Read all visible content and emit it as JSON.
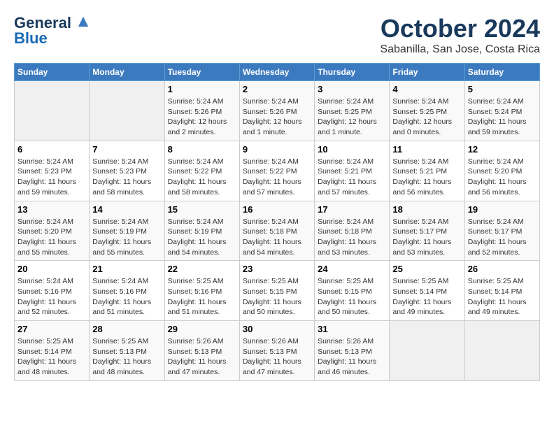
{
  "logo": {
    "general": "General",
    "blue": "Blue"
  },
  "title": "October 2024",
  "subtitle": "Sabanilla, San Jose, Costa Rica",
  "headers": [
    "Sunday",
    "Monday",
    "Tuesday",
    "Wednesday",
    "Thursday",
    "Friday",
    "Saturday"
  ],
  "weeks": [
    [
      {
        "day": "",
        "info": ""
      },
      {
        "day": "",
        "info": ""
      },
      {
        "day": "1",
        "info": "Sunrise: 5:24 AM\nSunset: 5:26 PM\nDaylight: 12 hours\nand 2 minutes."
      },
      {
        "day": "2",
        "info": "Sunrise: 5:24 AM\nSunset: 5:26 PM\nDaylight: 12 hours\nand 1 minute."
      },
      {
        "day": "3",
        "info": "Sunrise: 5:24 AM\nSunset: 5:25 PM\nDaylight: 12 hours\nand 1 minute."
      },
      {
        "day": "4",
        "info": "Sunrise: 5:24 AM\nSunset: 5:25 PM\nDaylight: 12 hours\nand 0 minutes."
      },
      {
        "day": "5",
        "info": "Sunrise: 5:24 AM\nSunset: 5:24 PM\nDaylight: 11 hours\nand 59 minutes."
      }
    ],
    [
      {
        "day": "6",
        "info": "Sunrise: 5:24 AM\nSunset: 5:23 PM\nDaylight: 11 hours\nand 59 minutes."
      },
      {
        "day": "7",
        "info": "Sunrise: 5:24 AM\nSunset: 5:23 PM\nDaylight: 11 hours\nand 58 minutes."
      },
      {
        "day": "8",
        "info": "Sunrise: 5:24 AM\nSunset: 5:22 PM\nDaylight: 11 hours\nand 58 minutes."
      },
      {
        "day": "9",
        "info": "Sunrise: 5:24 AM\nSunset: 5:22 PM\nDaylight: 11 hours\nand 57 minutes."
      },
      {
        "day": "10",
        "info": "Sunrise: 5:24 AM\nSunset: 5:21 PM\nDaylight: 11 hours\nand 57 minutes."
      },
      {
        "day": "11",
        "info": "Sunrise: 5:24 AM\nSunset: 5:21 PM\nDaylight: 11 hours\nand 56 minutes."
      },
      {
        "day": "12",
        "info": "Sunrise: 5:24 AM\nSunset: 5:20 PM\nDaylight: 11 hours\nand 56 minutes."
      }
    ],
    [
      {
        "day": "13",
        "info": "Sunrise: 5:24 AM\nSunset: 5:20 PM\nDaylight: 11 hours\nand 55 minutes."
      },
      {
        "day": "14",
        "info": "Sunrise: 5:24 AM\nSunset: 5:19 PM\nDaylight: 11 hours\nand 55 minutes."
      },
      {
        "day": "15",
        "info": "Sunrise: 5:24 AM\nSunset: 5:19 PM\nDaylight: 11 hours\nand 54 minutes."
      },
      {
        "day": "16",
        "info": "Sunrise: 5:24 AM\nSunset: 5:18 PM\nDaylight: 11 hours\nand 54 minutes."
      },
      {
        "day": "17",
        "info": "Sunrise: 5:24 AM\nSunset: 5:18 PM\nDaylight: 11 hours\nand 53 minutes."
      },
      {
        "day": "18",
        "info": "Sunrise: 5:24 AM\nSunset: 5:17 PM\nDaylight: 11 hours\nand 53 minutes."
      },
      {
        "day": "19",
        "info": "Sunrise: 5:24 AM\nSunset: 5:17 PM\nDaylight: 11 hours\nand 52 minutes."
      }
    ],
    [
      {
        "day": "20",
        "info": "Sunrise: 5:24 AM\nSunset: 5:16 PM\nDaylight: 11 hours\nand 52 minutes."
      },
      {
        "day": "21",
        "info": "Sunrise: 5:24 AM\nSunset: 5:16 PM\nDaylight: 11 hours\nand 51 minutes."
      },
      {
        "day": "22",
        "info": "Sunrise: 5:25 AM\nSunset: 5:16 PM\nDaylight: 11 hours\nand 51 minutes."
      },
      {
        "day": "23",
        "info": "Sunrise: 5:25 AM\nSunset: 5:15 PM\nDaylight: 11 hours\nand 50 minutes."
      },
      {
        "day": "24",
        "info": "Sunrise: 5:25 AM\nSunset: 5:15 PM\nDaylight: 11 hours\nand 50 minutes."
      },
      {
        "day": "25",
        "info": "Sunrise: 5:25 AM\nSunset: 5:14 PM\nDaylight: 11 hours\nand 49 minutes."
      },
      {
        "day": "26",
        "info": "Sunrise: 5:25 AM\nSunset: 5:14 PM\nDaylight: 11 hours\nand 49 minutes."
      }
    ],
    [
      {
        "day": "27",
        "info": "Sunrise: 5:25 AM\nSunset: 5:14 PM\nDaylight: 11 hours\nand 48 minutes."
      },
      {
        "day": "28",
        "info": "Sunrise: 5:25 AM\nSunset: 5:13 PM\nDaylight: 11 hours\nand 48 minutes."
      },
      {
        "day": "29",
        "info": "Sunrise: 5:26 AM\nSunset: 5:13 PM\nDaylight: 11 hours\nand 47 minutes."
      },
      {
        "day": "30",
        "info": "Sunrise: 5:26 AM\nSunset: 5:13 PM\nDaylight: 11 hours\nand 47 minutes."
      },
      {
        "day": "31",
        "info": "Sunrise: 5:26 AM\nSunset: 5:13 PM\nDaylight: 11 hours\nand 46 minutes."
      },
      {
        "day": "",
        "info": ""
      },
      {
        "day": "",
        "info": ""
      }
    ]
  ]
}
